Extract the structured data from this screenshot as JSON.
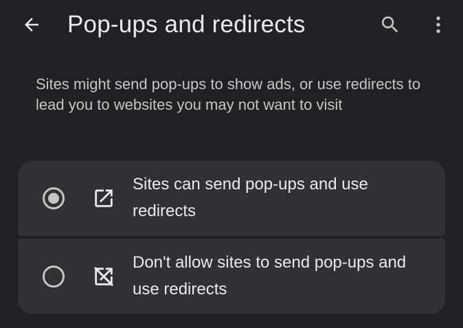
{
  "topbar": {
    "title": "Pop-ups and redirects",
    "back_icon": "arrow-back-icon",
    "search_icon": "search-icon",
    "more_icon": "more-vert-icon"
  },
  "description": "Sites might send pop-ups to show ads, or use redirects to lead you to websites you may not want to visit",
  "options": [
    {
      "label": "Sites can send pop-ups and use redirects",
      "icon": "open-in-new-icon",
      "selected": true
    },
    {
      "label": "Don't allow sites to send pop-ups and use redirects",
      "icon": "open-in-new-off-icon",
      "selected": false
    }
  ],
  "colors": {
    "background": "#202124",
    "card": "#303134",
    "text_primary": "#e8eaed",
    "text_secondary": "#c4c7c5"
  }
}
